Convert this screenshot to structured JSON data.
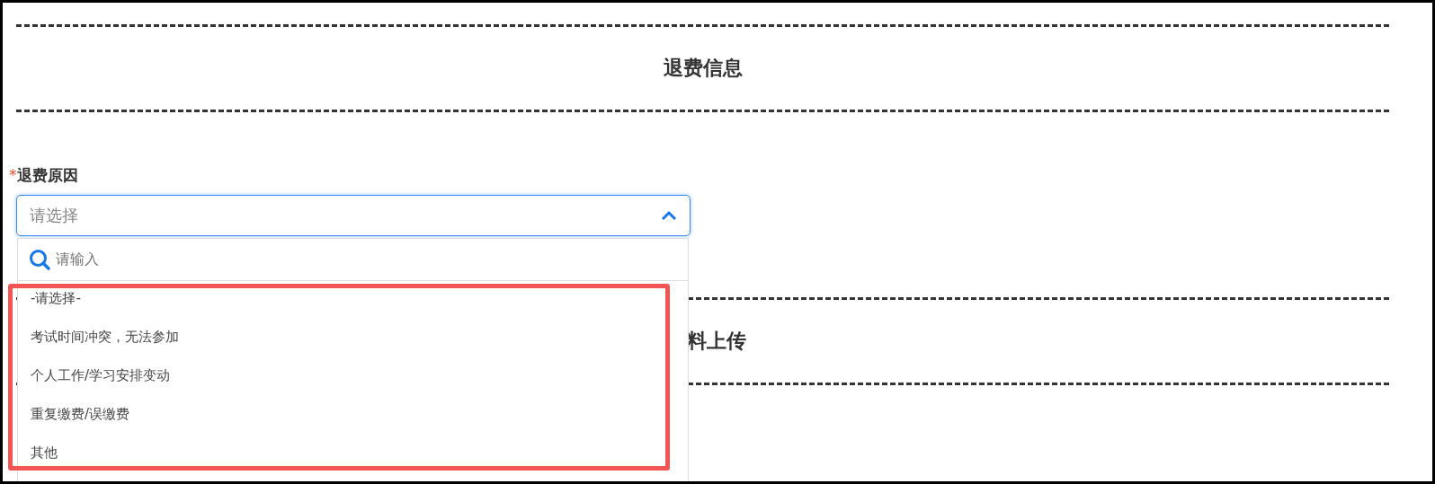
{
  "sections": [
    {
      "title": "退费信息"
    },
    {
      "title": "料上传"
    }
  ],
  "field": {
    "required_mark": "*",
    "label": "退费原因",
    "required": true,
    "placeholder": "请选择",
    "expanded": true
  },
  "dropdown": {
    "search_placeholder": "请输入",
    "options": [
      "-请选择-",
      "考试时间冲突，无法参加",
      "个人工作/学习安排变动",
      "重复缴费/误缴费",
      "其他"
    ]
  }
}
